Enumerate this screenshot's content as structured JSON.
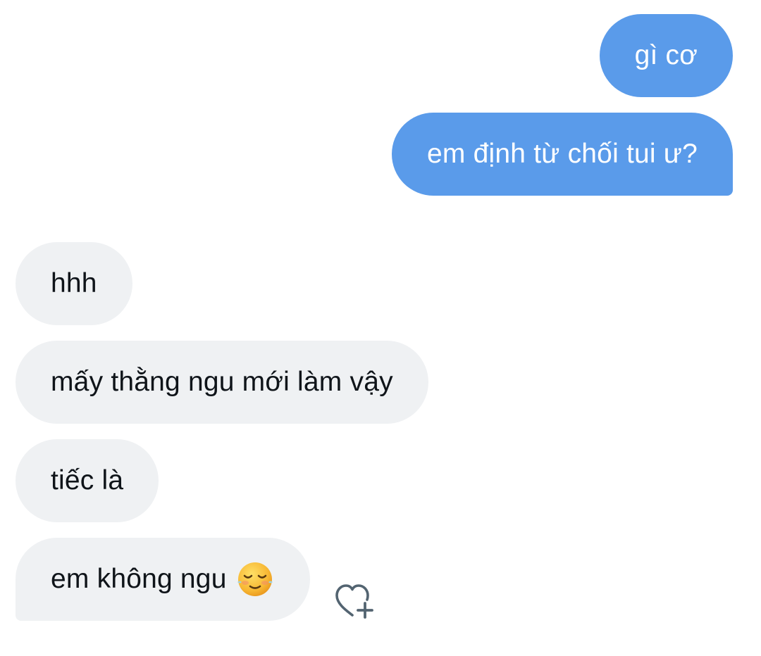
{
  "conversation": {
    "messages": [
      {
        "direction": "sent",
        "text": "gì cơ"
      },
      {
        "direction": "sent",
        "text": "em định từ chối tui ư?"
      },
      {
        "direction": "received",
        "text": "hhh"
      },
      {
        "direction": "received",
        "text": "mấy thằng ngu mới làm vậy"
      },
      {
        "direction": "received",
        "text": "tiếc là"
      },
      {
        "direction": "received",
        "text": "em không ngu",
        "emoji": "relieved-face-icon"
      }
    ],
    "reaction_button_icon": "heart-plus-icon"
  },
  "colors": {
    "sent_bubble": "#5a9bea",
    "received_bubble": "#eff1f3",
    "received_text": "#0f1419",
    "sent_text": "#ffffff",
    "reaction_icon": "#536471"
  }
}
